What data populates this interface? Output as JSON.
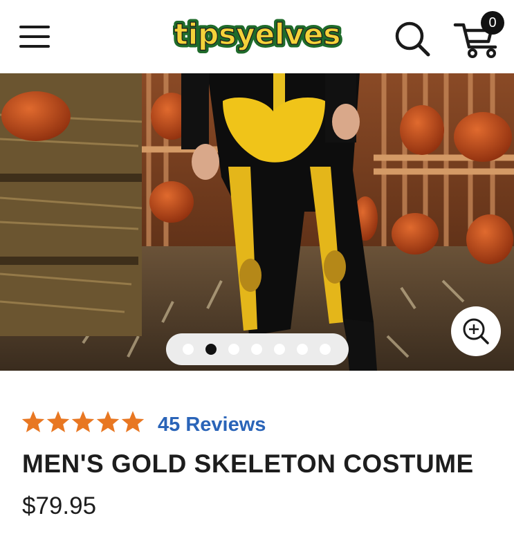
{
  "header": {
    "logo_text": "tipsyelves",
    "menu_icon": "hamburger-menu-icon",
    "search_icon": "search-icon",
    "cart_icon": "shopping-cart-icon",
    "cart_count": "0"
  },
  "gallery": {
    "image_count": 7,
    "active_index": 1,
    "zoom_icon": "zoom-in-icon"
  },
  "product": {
    "rating_stars": 5,
    "star_color": "#e87722",
    "reviews_label": "45 Reviews",
    "title": "MEN'S GOLD SKELETON COSTUME",
    "price": "$79.95"
  },
  "colors": {
    "logo_yellow": "#f4d23a",
    "logo_green": "#1f6b2b",
    "reviews_blue": "#2a64b8",
    "text_dark": "#1d1d1d"
  }
}
